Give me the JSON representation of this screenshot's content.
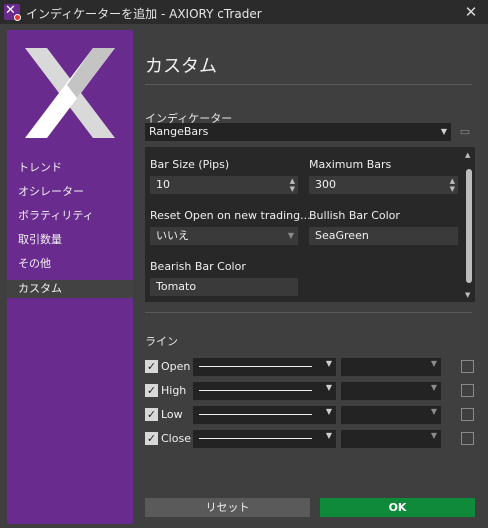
{
  "window": {
    "title": "インディケーターを追加 - AXIORY cTrader"
  },
  "sidebar": {
    "items": [
      {
        "label": "トレンド"
      },
      {
        "label": "オシレーター"
      },
      {
        "label": "ボラティリティ"
      },
      {
        "label": "取引数量"
      },
      {
        "label": "その他"
      },
      {
        "label": "カスタム"
      }
    ],
    "selected": "カスタム"
  },
  "main": {
    "title": "カスタム",
    "indicator_label": "インディケーター",
    "indicator_value": "RangeBars",
    "params": {
      "bar_size_label": "Bar Size (Pips)",
      "bar_size_value": "10",
      "max_bars_label": "Maximum Bars",
      "max_bars_value": "300",
      "reset_open_label": "Reset Open on new trading...",
      "reset_open_value": "いいえ",
      "bullish_label": "Bullish Bar Color",
      "bullish_value": "SeaGreen",
      "bearish_label": "Bearish Bar Color",
      "bearish_value": "Tomato"
    },
    "lines_label": "ライン",
    "lines": [
      {
        "label": "Open",
        "checked": true
      },
      {
        "label": "High",
        "checked": true
      },
      {
        "label": "Low",
        "checked": true
      },
      {
        "label": "Close",
        "checked": true
      }
    ]
  },
  "buttons": {
    "reset": "リセット",
    "ok": "OK"
  },
  "colors": {
    "sidebar": "#6a2b8e",
    "ok": "#0f8a3a",
    "background": "#3f3f3f"
  },
  "icons": {
    "app": "axiory-x-logo",
    "close": "close-icon",
    "camera": "camera-icon"
  }
}
